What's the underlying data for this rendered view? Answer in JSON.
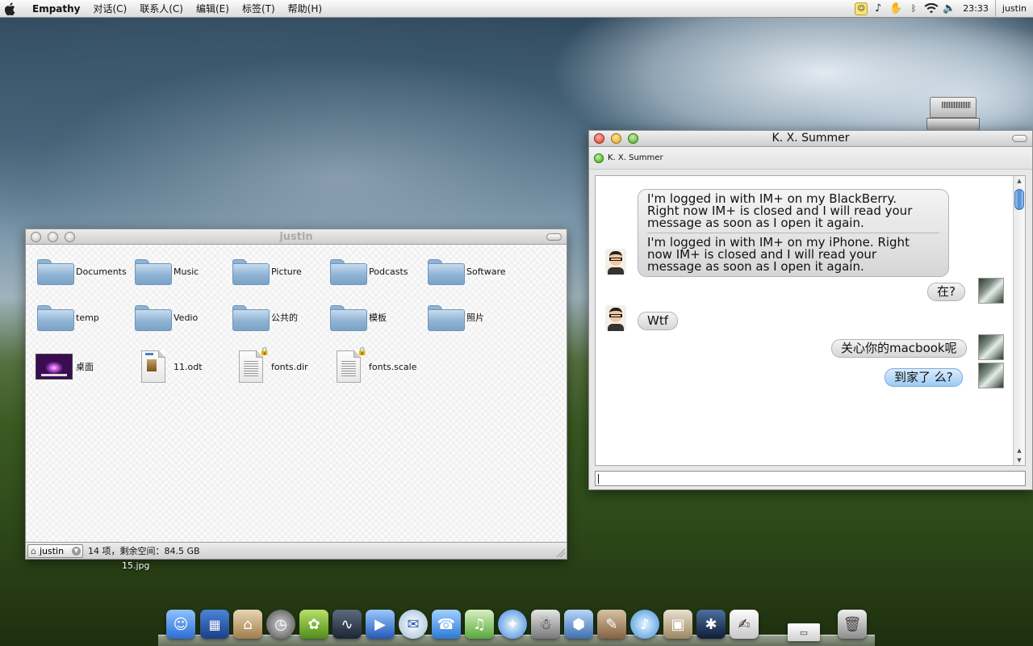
{
  "menubar": {
    "app_name": "Empathy",
    "menus": [
      "对话(C)",
      "联系人(C)",
      "编辑(E)",
      "标签(T)",
      "帮助(H)"
    ],
    "clock": "23:33",
    "user": "justin"
  },
  "finder": {
    "title": "justin",
    "items": [
      {
        "label": "Documents",
        "icon": "folder-icon"
      },
      {
        "label": "Music",
        "icon": "folder-icon"
      },
      {
        "label": "Picture",
        "icon": "folder-icon"
      },
      {
        "label": "Podcasts",
        "icon": "folder-icon"
      },
      {
        "label": "Software",
        "icon": "folder-icon"
      },
      {
        "label": "temp",
        "icon": "folder-icon"
      },
      {
        "label": "Vedio",
        "icon": "folder-icon"
      },
      {
        "label": "公共的",
        "icon": "folder-icon"
      },
      {
        "label": "模板",
        "icon": "folder-icon"
      },
      {
        "label": "照片",
        "icon": "folder-icon"
      },
      {
        "label": "桌面",
        "icon": "desktop-folder-icon"
      },
      {
        "label": "11.odt",
        "icon": "document-icon"
      },
      {
        "label": "fonts.dir",
        "icon": "text-file-icon"
      },
      {
        "label": "fonts.scale",
        "icon": "text-file-icon"
      }
    ],
    "path_button": "justin",
    "status": "14 项，剩余空间：84.5 GB"
  },
  "desktop": {
    "file_label": "15.jpg"
  },
  "chat": {
    "title": "K. X. Summer",
    "contact_name": "K. X. Summer",
    "messages": [
      {
        "from": "them",
        "lines": [
          "I'm logged in with IM+ on my BlackBerry.",
          "Right now IM+ is closed and I will read your",
          "message as soon as I open it again."
        ]
      },
      {
        "from": "them",
        "lines": [
          "I'm logged in with IM+ on my iPhone. Right",
          "now IM+ is closed and I will read your",
          "message as soon as I open it again."
        ]
      },
      {
        "from": "me",
        "text": "在?"
      },
      {
        "from": "them",
        "text": "Wtf"
      },
      {
        "from": "me",
        "text": "关心你的macbook呢"
      },
      {
        "from": "me",
        "text": "到家了 么?"
      }
    ],
    "input_value": ""
  },
  "colors": {
    "accent_blue": "#4a8ad6",
    "online_green": "#3ba418"
  }
}
